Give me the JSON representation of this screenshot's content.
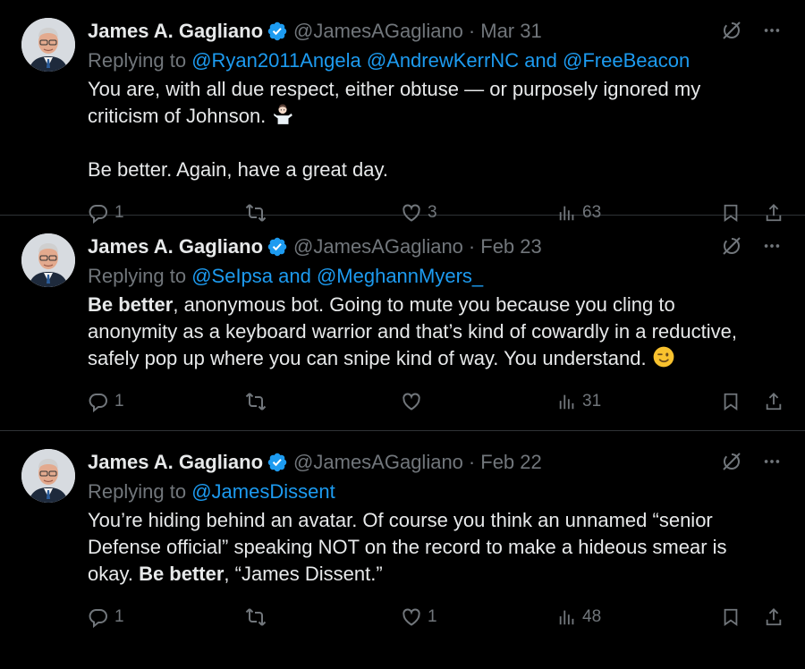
{
  "colors": {
    "background": "#000000",
    "text": "#e7e9ea",
    "muted": "#71767b",
    "link": "#1d9bf0",
    "verified": "#1d9bf0",
    "divider": "#2f3336"
  },
  "tweets": [
    {
      "name": "James A. Gagliano",
      "handle": "@JamesAGagliano",
      "separator": "·",
      "date": "Mar 31",
      "replying_prefix": "Replying to",
      "replying_mentions": "@Ryan2011Angela @AndrewKerrNC and @FreeBeacon",
      "line1": "You are, with all due respect, either obtuse — or purposely ignored my",
      "line2": "criticism of Johnson.",
      "line3": "Be better. Again, have a great day.",
      "reply_count": "1",
      "retweet_count": "",
      "like_count": "3",
      "view_count": "63",
      "icons": [
        "verified-badge-icon",
        "grok-icon",
        "more-icon",
        "reply-icon",
        "retweet-icon",
        "like-icon",
        "views-icon",
        "bookmark-icon",
        "share-icon",
        "person-shrugging-emoji"
      ]
    },
    {
      "name": "James A. Gagliano",
      "handle": "@JamesAGagliano",
      "separator": "·",
      "date": "Feb 23",
      "replying_prefix": "Replying to",
      "replying_mentions": "@SeIpsa and @MeghannMyers_",
      "bold_lead": "Be better",
      "line1_rest": ", anonymous bot. Going to mute you because you cling to",
      "line2": "anonymity as a keyboard warrior and that’s kind of cowardly in a reductive,",
      "line3": "safely pop up where you can snipe kind of way. You understand.",
      "reply_count": "1",
      "retweet_count": "",
      "like_count": "",
      "view_count": "31",
      "icons": [
        "winking-face-emoji"
      ]
    },
    {
      "name": "James A. Gagliano",
      "handle": "@JamesAGagliano",
      "separator": "·",
      "date": "Feb 22",
      "replying_prefix": "Replying to",
      "replying_mentions": "@JamesDissent",
      "line1": "You’re hiding behind an avatar. Of course you think an unnamed “senior",
      "line2": "Defense official” speaking NOT on the record to make a hideous smear is",
      "line3_start": "okay. ",
      "line3_bold": "Be better",
      "line3_end": ", “James Dissent.”",
      "reply_count": "1",
      "retweet_count": "",
      "like_count": "1",
      "view_count": "48"
    }
  ]
}
